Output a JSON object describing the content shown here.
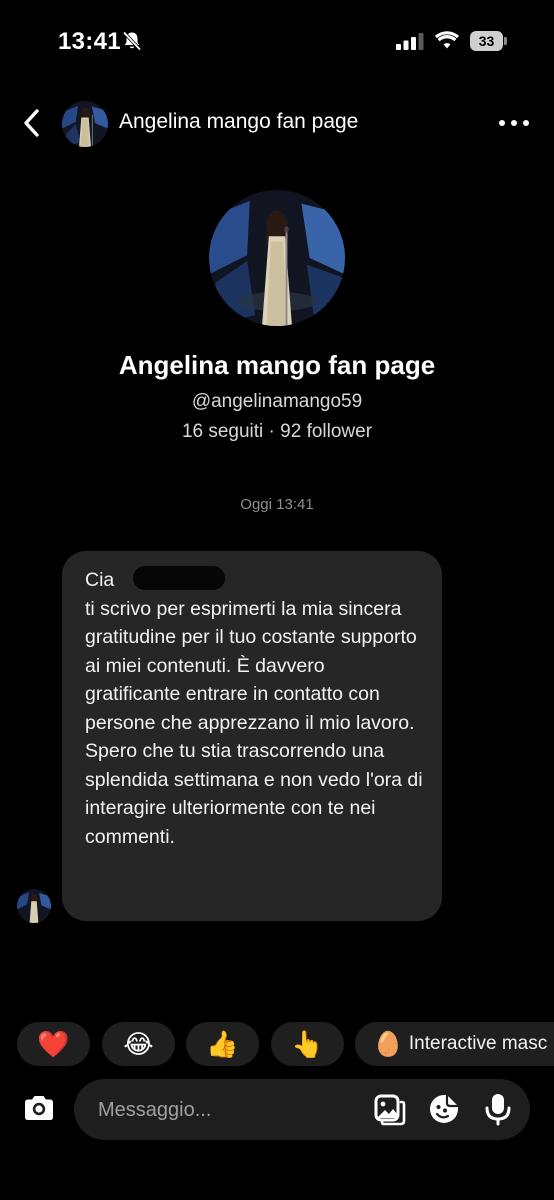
{
  "status_bar": {
    "time": "13:41",
    "battery": "33",
    "silent_icon": "bell-slash-icon",
    "signal_icon": "cellular-signal-icon",
    "wifi_icon": "wifi-icon"
  },
  "header": {
    "title": "Angelina mango fan page",
    "back_icon": "chevron-left-icon",
    "more_icon": "more-horizontal-icon"
  },
  "profile": {
    "name": "Angelina mango fan page",
    "handle": "@angelinamango59",
    "stats": "16 seguiti · 92 follower"
  },
  "conversation": {
    "timestamp": "Oggi 13:41",
    "message": "Cia\nti scrivo per esprimerti la mia sincera gratitudine per il tuo costante supporto ai miei contenuti. È davvero gratificante entrare in contatto con persone che apprezzano il mio lavoro. Spero che tu stia trascorrendo una splendida settimana e non vedo l'ora di interagire ulteriormente con te nei commenti."
  },
  "quick_reactions": [
    {
      "emoji": "❤️",
      "name": "red-heart"
    },
    {
      "emoji": "😂",
      "name": "tears-of-joy"
    },
    {
      "emoji": "👍",
      "name": "thumbs-up"
    },
    {
      "emoji": "👆",
      "name": "pointing-up"
    }
  ],
  "interactive_chip": {
    "emoji": "🥚",
    "label": "Interactive masc"
  },
  "composer": {
    "placeholder": "Messaggio...",
    "icons": [
      "camera-icon",
      "gallery-icon",
      "sticker-icon",
      "microphone-icon"
    ]
  },
  "colors": {
    "background": "#000000",
    "bubble": "#262626",
    "composer": "#1e1e1e",
    "muted_text": "#8e8e8e"
  }
}
